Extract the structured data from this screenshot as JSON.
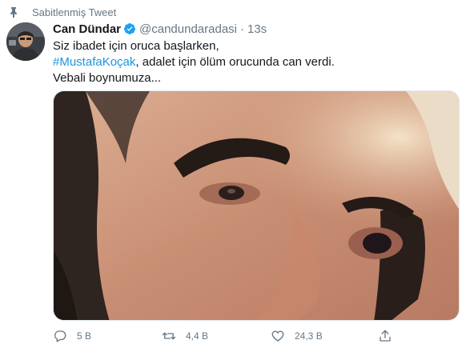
{
  "pinned": {
    "label": "Sabitlenmiş Tweet"
  },
  "author": {
    "name": "Can Dündar",
    "handle": "@candundaradasi",
    "separator": "·",
    "time": "13s"
  },
  "tweet": {
    "line1": "Siz ibadet için oruca başlarken,",
    "hashtag": "#MustafaKoçak",
    "line2_rest": ", adalet için ölüm orucunda can verdi.",
    "line3": "Vebali boynumuza..."
  },
  "actions": {
    "reply_count": "5 B",
    "retweet_count": "4,4 B",
    "like_count": "24,3 B"
  },
  "colors": {
    "accent": "#1da1f2",
    "hashtag": "#1b95e0",
    "muted": "#657786",
    "text": "#14171a"
  },
  "icons": {
    "pin": "pin-icon",
    "verified": "verified-badge-icon",
    "reply": "reply-icon",
    "retweet": "retweet-icon",
    "like": "heart-icon",
    "share": "share-icon"
  }
}
